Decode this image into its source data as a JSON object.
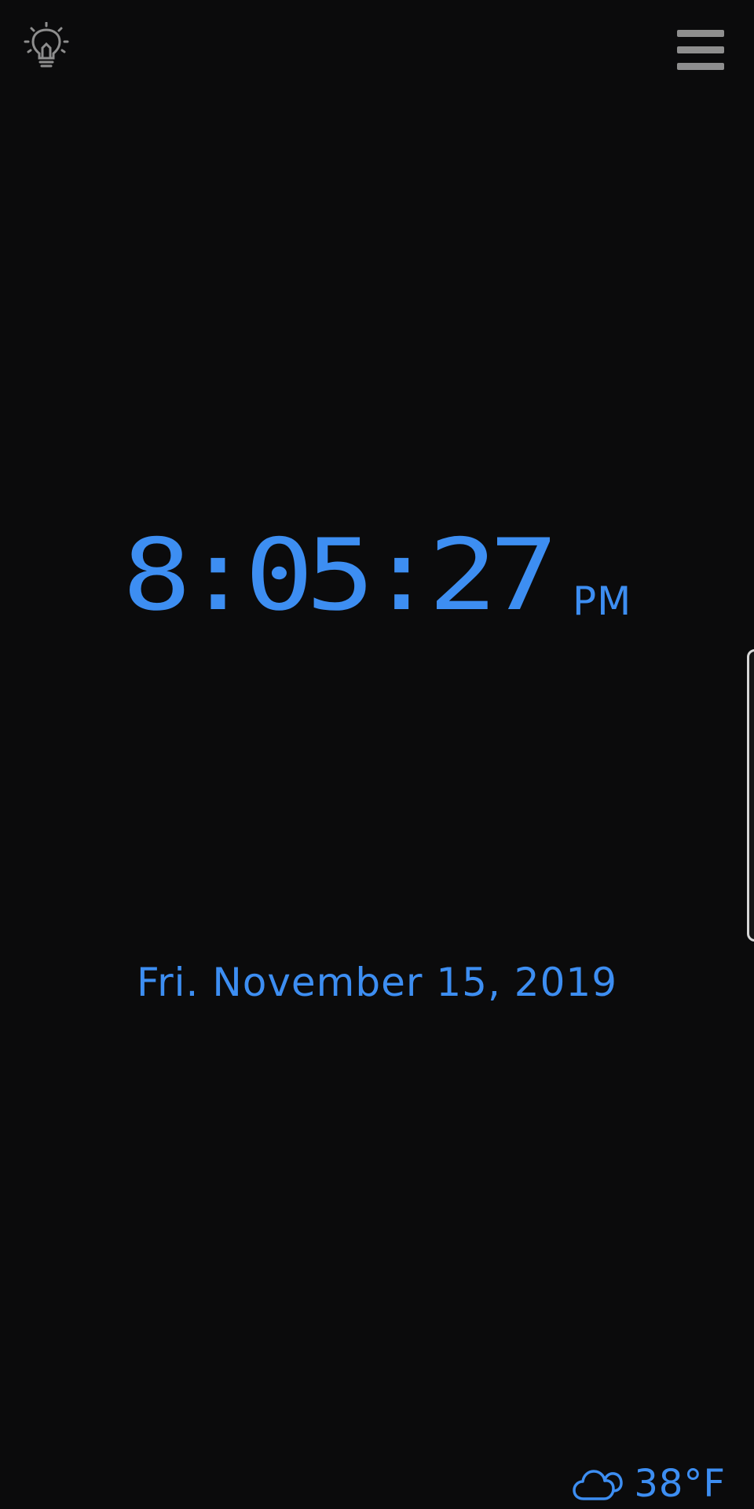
{
  "colors": {
    "background": "#0b0b0c",
    "accent": "#3d8ef2",
    "icon_gray": "#8e8e8e"
  },
  "toolbar": {
    "light_icon": "light-bulb-icon",
    "menu_icon": "hamburger-menu-icon"
  },
  "clock": {
    "time": "8:05:27",
    "ampm": "PM"
  },
  "date": {
    "text": "Fri. November 15, 2019"
  },
  "weather": {
    "icon": "cloud-icon",
    "temperature": "38°F"
  },
  "edge_panel": {
    "icon": "edge-panel-handle"
  }
}
